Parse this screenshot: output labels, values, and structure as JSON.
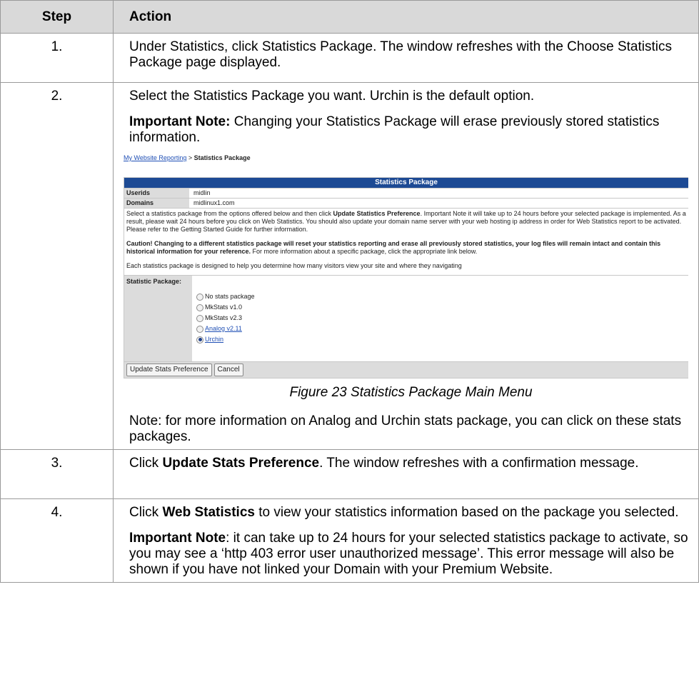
{
  "header": {
    "step": "Step",
    "action": "Action"
  },
  "rows": [
    {
      "num": "1.",
      "text": "Under Statistics, click Statistics Package. The window refreshes with the Choose Statistics Package page displayed."
    },
    {
      "num": "2.",
      "text": "Select the Statistics Package you want. Urchin is the default option.",
      "note_label": "Important Note:",
      "note_text": " Changing your Statistics Package will erase previously stored statistics information.",
      "caption": "Figure 23 Statistics Package Main Menu",
      "after": "Note: for more information on Analog and Urchin stats package, you can click on these stats packages."
    },
    {
      "num": "3.",
      "pre": "Click ",
      "bold": "Update Stats Preference",
      "post": ". The window refreshes with a confirmation message."
    },
    {
      "num": "4.",
      "pre": "Click ",
      "bold": "Web Statistics",
      "post": " to view your statistics information based on the package you selected.",
      "note_label": "Important Note",
      "note_text": ": it can take up to 24 hours for your selected statistics package to activate, so you may see a ‘http 403 error user unauthorized message’. This error message will also be shown if you have not linked your Domain with your Premium Website."
    }
  ],
  "screenshot": {
    "crumb_link": "My Website Reporting",
    "crumb_sep": " > ",
    "crumb_current": "Statistics Package",
    "title": "Statistics Package",
    "userids_label": "Userids",
    "userids_value": "midlin",
    "domains_label": "Domains",
    "domains_value": "midlinux1.com",
    "intro_pre": "Select a statistics package from the options offered below and then click ",
    "intro_bold": "Update Statistics Preference",
    "intro_post": ". Important Note it will take up to 24 hours before your selected package is implemented. As a result, please wait 24 hours before you click on Web Statistics. You should also update your domain name server with your web hosting ip address in order for Web Statistics report to be activated. Please refer to the Getting Started Guide for further information.",
    "caution_bold": "Caution! Changing to a different statistics package will reset your statistics reporting and erase all previously stored statistics, your log files will remain intact and contain this historical information for your reference.",
    "caution_post": " For more information about a specific package, click the appropriate link below.",
    "each": "Each statistics package is designed to help you determine how many visitors view your site and where they navigating",
    "pkg_label": "Statistic Package:",
    "options": [
      {
        "label": "No stats package",
        "link": false,
        "checked": false
      },
      {
        "label": "MkStats v1.0",
        "link": false,
        "checked": false
      },
      {
        "label": "MkStats v2.3",
        "link": false,
        "checked": false
      },
      {
        "label": "Analog v2.11",
        "link": true,
        "checked": false
      },
      {
        "label": "Urchin",
        "link": true,
        "checked": true
      }
    ],
    "btn_update": "Update Stats Preference",
    "btn_cancel": "Cancel"
  }
}
